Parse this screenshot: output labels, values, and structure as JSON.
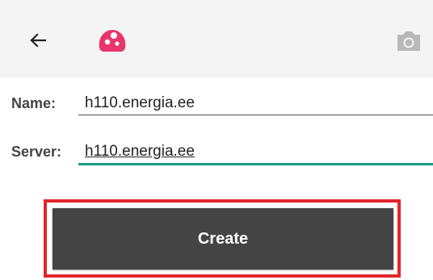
{
  "toolbar": {
    "back_icon": "arrow-left-icon",
    "logo_icon": "app-logo-icon",
    "camera_icon": "camera-icon",
    "logo_color": "#e8356b",
    "background": "#f4f4f4"
  },
  "form": {
    "name_label": "Name:",
    "name_value": "h110.energia.ee",
    "server_label": "Server:",
    "server_value": "h110.energia.ee",
    "accent_color": "#1a9a86"
  },
  "actions": {
    "create_label": "Create",
    "button_color": "#444444",
    "highlight_color": "#e3262b"
  }
}
